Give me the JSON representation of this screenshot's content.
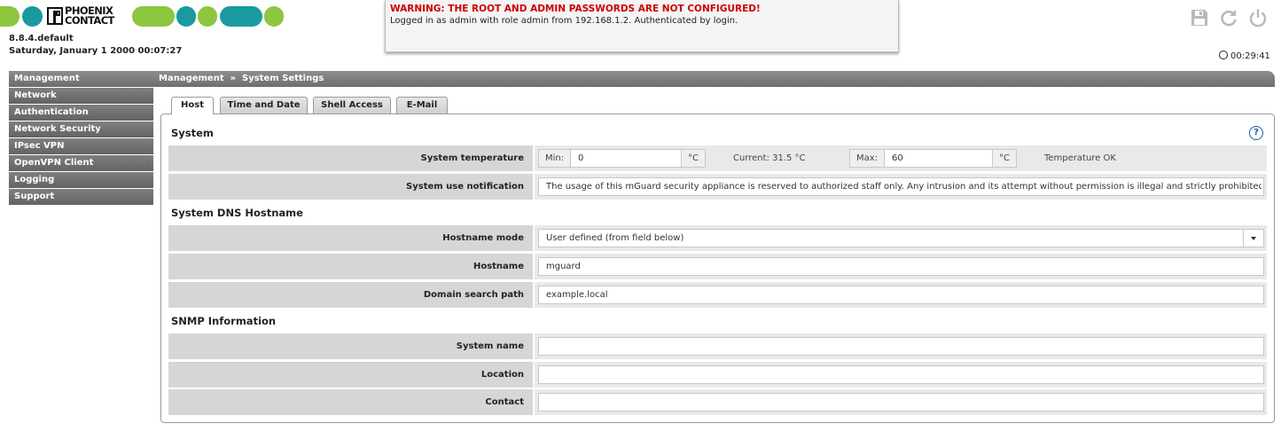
{
  "header": {
    "logo_text": "PHOENIX\nCONTACT",
    "version": "8.8.4.default",
    "datetime": "Saturday, January 1 2000 00:07:27",
    "warning": "WARNING: THE ROOT AND ADMIN PASSWORDS ARE NOT CONFIGURED!",
    "login_info": "Logged in as admin with role admin from 192.168.1.2. Authenticated by login.",
    "session_timer": "00:29:41",
    "icons": [
      "save-icon",
      "refresh-icon",
      "power-icon"
    ],
    "brand_colors": {
      "green": "#8dc63f",
      "teal": "#1a9a9e"
    }
  },
  "sidebar": {
    "items": [
      {
        "label": "Management"
      },
      {
        "label": "Network"
      },
      {
        "label": "Authentication"
      },
      {
        "label": "Network Security"
      },
      {
        "label": "IPsec VPN"
      },
      {
        "label": "OpenVPN Client"
      },
      {
        "label": "Logging"
      },
      {
        "label": "Support"
      }
    ]
  },
  "breadcrumb": {
    "text": "Management  »  System Settings"
  },
  "tabs": [
    {
      "label": "Host",
      "active": true
    },
    {
      "label": "Time and Date"
    },
    {
      "label": "Shell Access"
    },
    {
      "label": "E-Mail"
    }
  ],
  "system": {
    "title": "System",
    "temperature": {
      "label": "System temperature",
      "min_label": "Min:",
      "min_value": "0",
      "unit": "°C",
      "current": "Current: 31.5 °C",
      "max_label": "Max:",
      "max_value": "60",
      "status": "Temperature OK"
    },
    "notification": {
      "label": "System use notification",
      "value": "The usage of this mGuard security appliance is reserved to authorized staff only. Any intrusion and its attempt without permission is illegal and strictly prohibited."
    }
  },
  "dns": {
    "title": "System DNS Hostname",
    "mode": {
      "label": "Hostname mode",
      "value": "User defined (from field below)"
    },
    "hostname": {
      "label": "Hostname",
      "value": "mguard"
    },
    "search": {
      "label": "Domain search path",
      "value": "example.local"
    }
  },
  "snmp": {
    "title": "SNMP Information",
    "system_name": {
      "label": "System name",
      "value": ""
    },
    "location": {
      "label": "Location",
      "value": ""
    },
    "contact": {
      "label": "Contact",
      "value": ""
    }
  }
}
